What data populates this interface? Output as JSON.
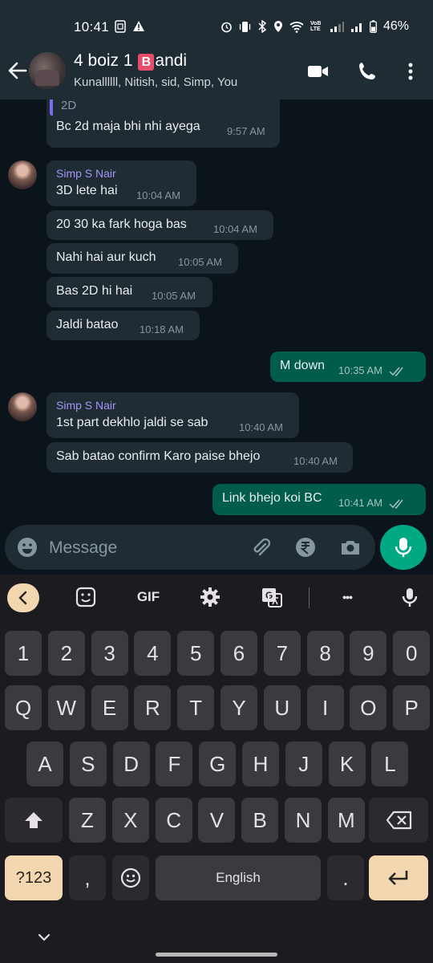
{
  "status_bar": {
    "time": "10:41",
    "network_label": "VoB LTE",
    "battery": "46%"
  },
  "header": {
    "title_prefix": "4 boiz  1 ",
    "title_badge": "B",
    "title_suffix": "andi",
    "subtitle": "Kunallllll, Nitish, sid, Simp, You"
  },
  "messages": [
    {
      "type": "in",
      "quoted": "2D",
      "text": "Bc 2d maja bhi nhi ayega",
      "time": "9:57 AM"
    },
    {
      "type": "in",
      "sender": "Simp S Nair",
      "text": "3D lete hai",
      "time": "10:04 AM"
    },
    {
      "type": "in",
      "text": "20 30 ka fark hoga bas",
      "time": "10:04 AM"
    },
    {
      "type": "in",
      "text": "Nahi hai aur kuch",
      "time": "10:05 AM"
    },
    {
      "type": "in",
      "text": "Bas 2D hi hai",
      "time": "10:05 AM"
    },
    {
      "type": "in",
      "text": "Jaldi batao",
      "time": "10:18 AM"
    },
    {
      "type": "out",
      "text": "M down",
      "time": "10:35 AM"
    },
    {
      "type": "in",
      "sender": "Simp S Nair",
      "text": "1st part dekhlo jaldi se sab",
      "time": "10:40 AM"
    },
    {
      "type": "in",
      "text": "Sab batao confirm Karo paise bhejo",
      "time": "10:40 AM"
    },
    {
      "type": "out",
      "text": "Link bhejo koi BC",
      "time": "10:41 AM"
    }
  ],
  "composer": {
    "placeholder": "Message"
  },
  "keyboard": {
    "gif_label": "GIF",
    "more_label": "•••",
    "row_numbers": [
      "1",
      "2",
      "3",
      "4",
      "5",
      "6",
      "7",
      "8",
      "9",
      "0"
    ],
    "row_top": [
      "Q",
      "W",
      "E",
      "R",
      "T",
      "Y",
      "U",
      "I",
      "O",
      "P"
    ],
    "row_middle": [
      "A",
      "S",
      "D",
      "F",
      "G",
      "H",
      "J",
      "K",
      "L"
    ],
    "row_bottom": [
      "Z",
      "X",
      "C",
      "V",
      "B",
      "N",
      "M"
    ],
    "symbols_key": "?123",
    "comma_key": ",",
    "space_label": "English",
    "period_key": "."
  },
  "colors": {
    "incoming_bubble": "#1f2c34",
    "outgoing_bubble": "#005c4b",
    "sender_name": "#a594f9",
    "accent_green": "#00a884",
    "keyboard_accent": "#f2d7b0"
  }
}
